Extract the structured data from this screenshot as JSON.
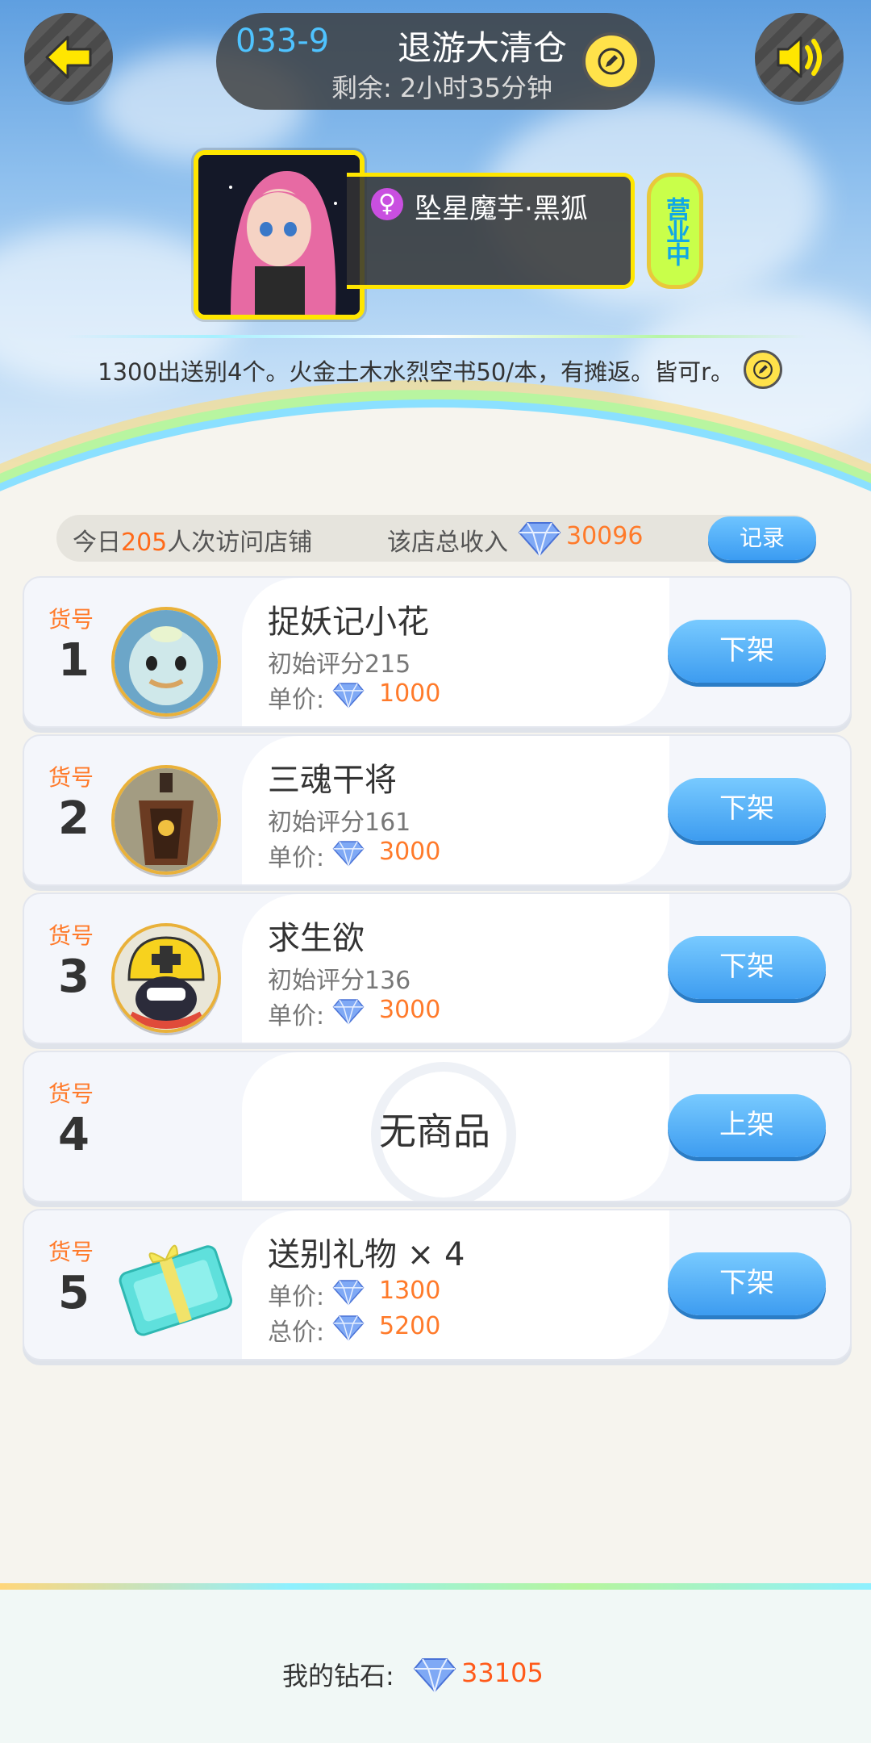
{
  "header": {
    "shop_code": "033-9",
    "shop_name": "退游大清仓",
    "remaining": "剩余: 2小时35分钟",
    "host_name": "坠星魔芋·黑狐",
    "gender_symbol": "♀",
    "status_badge": "营业中",
    "notice": "1300出送别4个。火金土木水烈空书50/本，有摊返。皆可r。"
  },
  "stats": {
    "visits_prefix": "今日",
    "visits_count": "205",
    "visits_suffix": "人次访问店铺",
    "income_label": "该店总收入",
    "income_value": "30096",
    "record_button": "记录"
  },
  "slots": [
    {
      "no_label": "货号",
      "no": "1",
      "name": "捉妖记小花",
      "line1": "初始评分215",
      "price_label": "单价:",
      "price": "1000",
      "button": "下架"
    },
    {
      "no_label": "货号",
      "no": "2",
      "name": "三魂干将",
      "line1": "初始评分161",
      "price_label": "单价:",
      "price": "3000",
      "button": "下架"
    },
    {
      "no_label": "货号",
      "no": "3",
      "name": "求生欲",
      "line1": "初始评分136",
      "price_label": "单价:",
      "price": "3000",
      "button": "下架"
    },
    {
      "no_label": "货号",
      "no": "4",
      "empty_text": "无商品",
      "button": "上架"
    },
    {
      "no_label": "货号",
      "no": "5",
      "name": "送别礼物 × 4",
      "price_label": "单价:",
      "price": "1300",
      "total_label": "总价:",
      "total": "5200",
      "button": "下架"
    }
  ],
  "footer": {
    "label": "我的钻石:",
    "value": "33105"
  },
  "colors": {
    "accent_orange": "#ff7a2a",
    "button_blue": "#3d9cf0",
    "frame_yellow": "#ffe600"
  }
}
